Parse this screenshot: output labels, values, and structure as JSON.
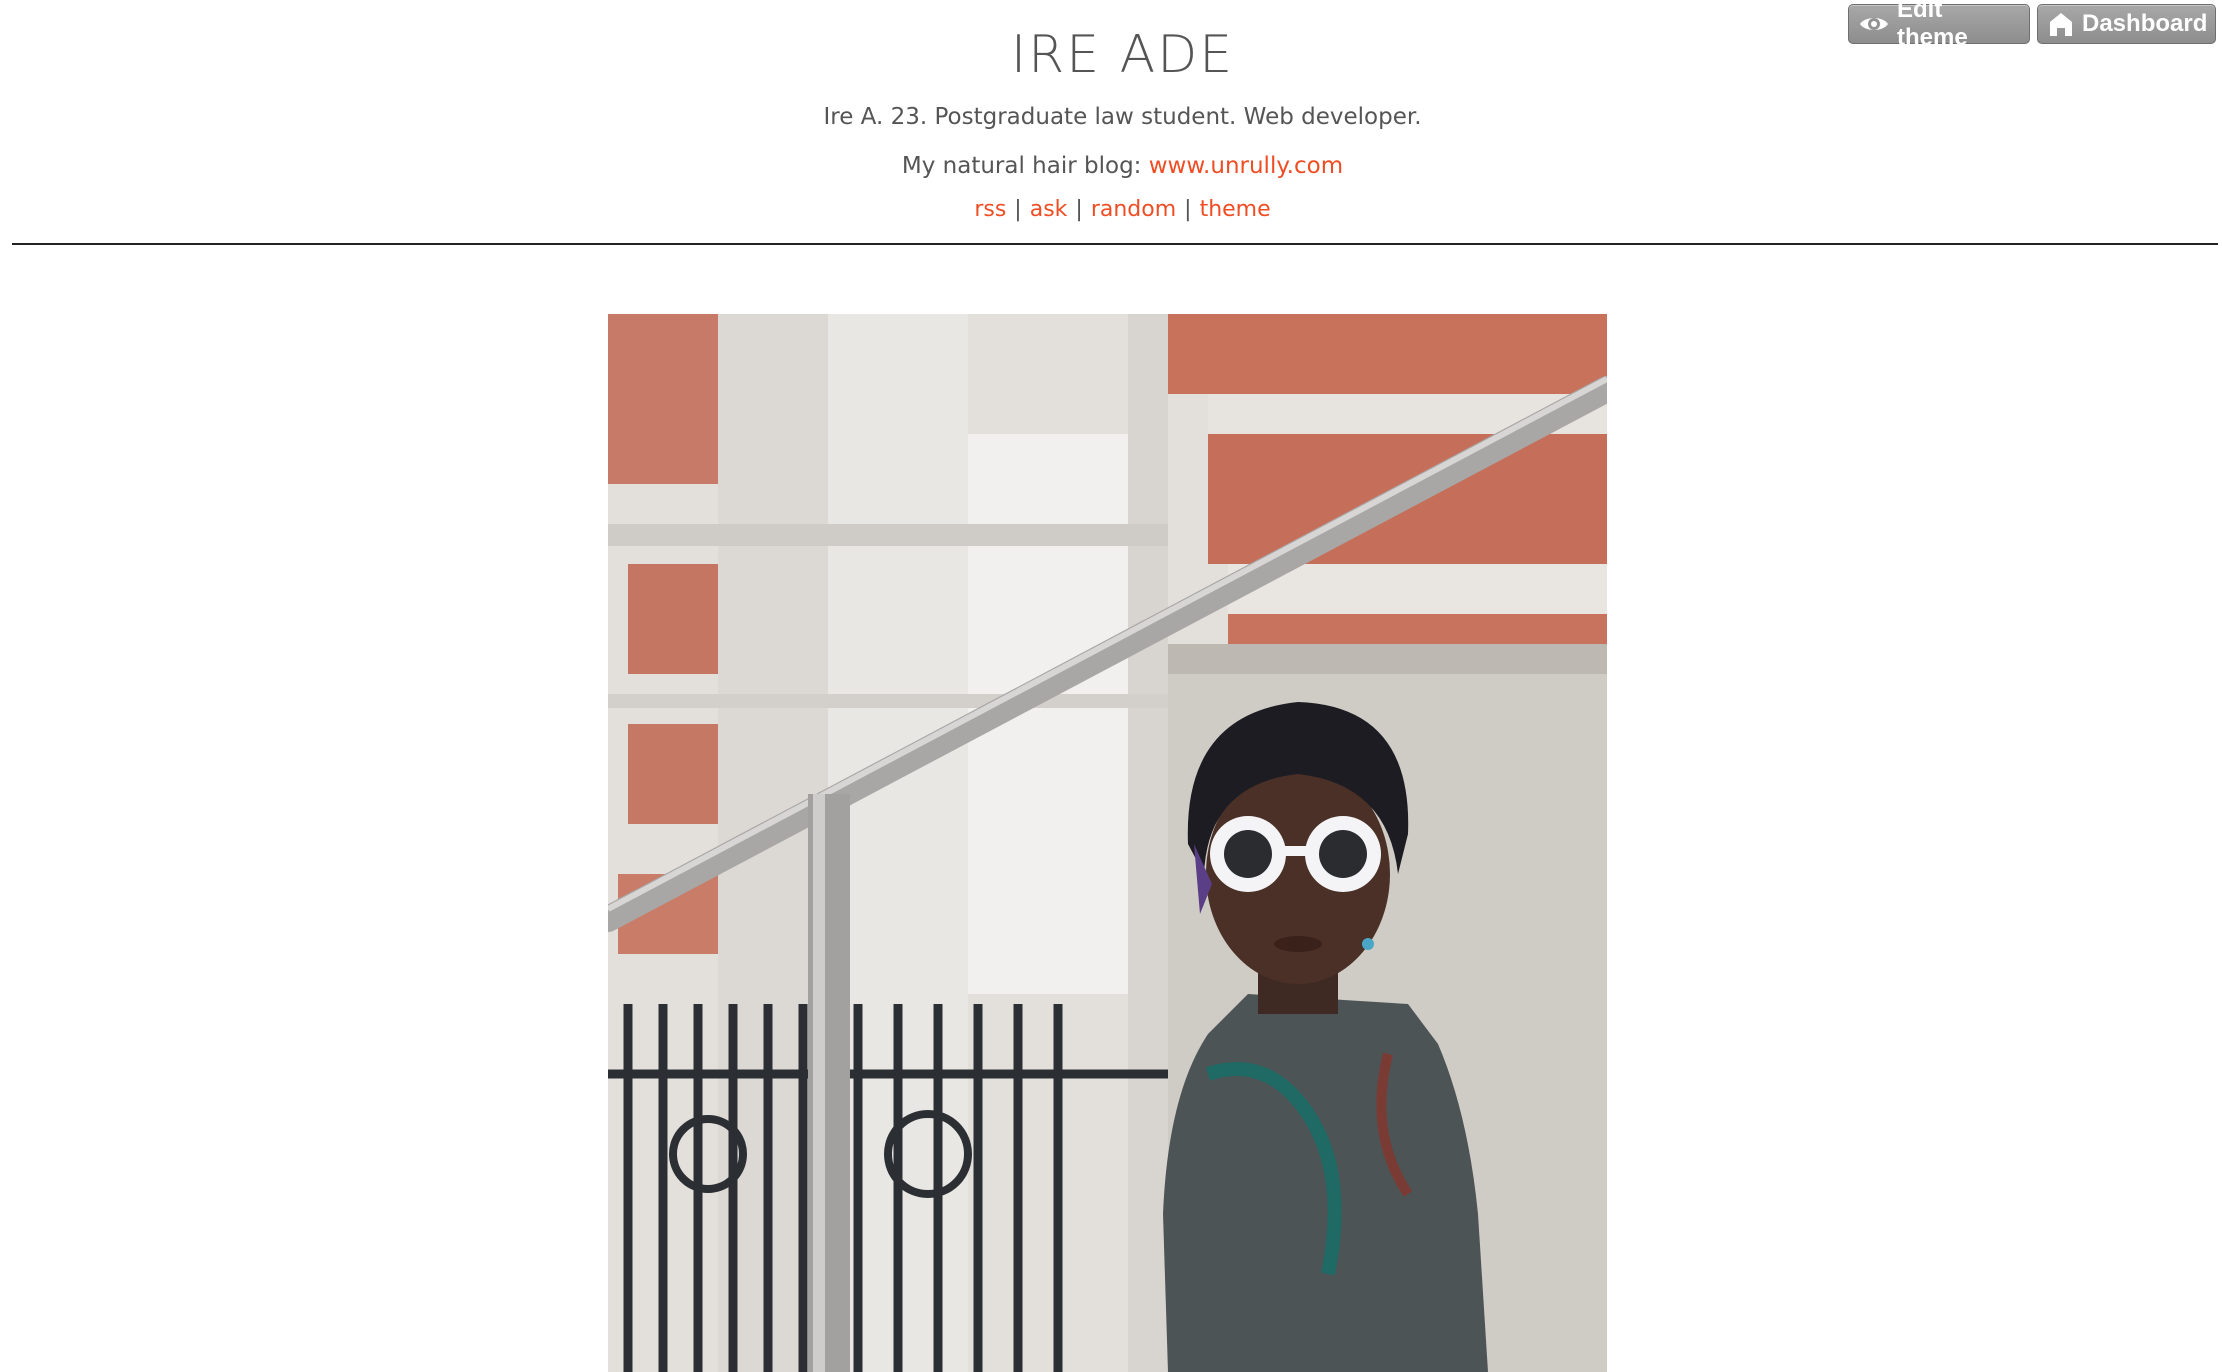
{
  "controls": {
    "edit_theme_label": "Edit theme",
    "dashboard_label": "Dashboard"
  },
  "header": {
    "title": "IRE ADE",
    "description": "Ire A. 23. Postgraduate law student. Web developer.",
    "hair_blog_prefix": "My natural hair blog:",
    "hair_blog_link": "www.unrully.com",
    "nav": {
      "rss": "rss",
      "ask": "ask",
      "random": "random",
      "theme": "theme",
      "separator": "|"
    }
  },
  "colors": {
    "accent": "#ef4d24",
    "text": "#555555",
    "divider": "#222222",
    "button_bg": "#999999"
  },
  "icons": {
    "edit_theme": "eye-icon",
    "dashboard": "home-icon"
  }
}
